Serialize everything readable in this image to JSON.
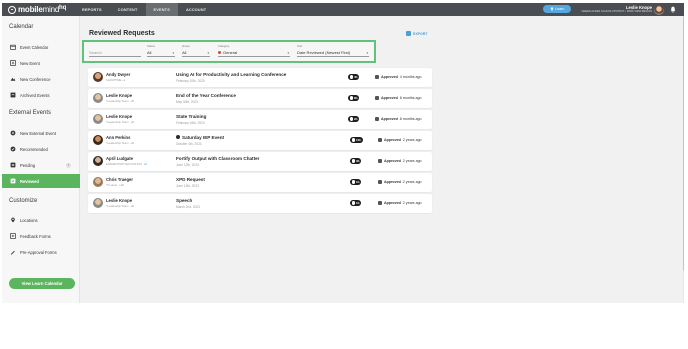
{
  "topbar": {
    "logo_brand": "mobile",
    "logo_brand2": "mind",
    "logo_suffix": "hq",
    "nav": [
      "REPORTS",
      "CONTENT",
      "EVENTS",
      "ACCOUNT"
    ],
    "active_nav": "EVENTS",
    "learn_label": "Learn",
    "user_name": "Leslie Knope",
    "user_district": "GREEN ACRES SCHOOL DISTRICT • PARK VIEW REGION",
    "icons": [
      "logo-icon",
      "lightbulb-icon",
      "avatar",
      "bell-icon"
    ]
  },
  "sidebar": {
    "sections": [
      {
        "title": "Calendar",
        "items": [
          {
            "label": "Event Calendar",
            "icon": "calendar-icon"
          },
          {
            "label": "New Event",
            "icon": "new-event-icon"
          },
          {
            "label": "New Conference",
            "icon": "conference-icon"
          },
          {
            "label": "Archived Events",
            "icon": "archive-icon"
          }
        ]
      },
      {
        "title": "External Events",
        "items": [
          {
            "label": "New External Event",
            "icon": "plus-circle-icon"
          },
          {
            "label": "Recommended",
            "icon": "check-circle-icon"
          },
          {
            "label": "Pending",
            "icon": "pending-icon"
          },
          {
            "label": "Reviewed",
            "icon": "reviewed-icon"
          }
        ]
      },
      {
        "title": "Customize",
        "items": [
          {
            "label": "Locations",
            "icon": "location-icon"
          },
          {
            "label": "Feedback Forms",
            "icon": "feedback-icon"
          },
          {
            "label": "Pre-Approval Forms",
            "icon": "preapproval-icon"
          }
        ]
      }
    ],
    "active_item": "Reviewed",
    "view_button": "View Learn Calendar"
  },
  "main": {
    "title": "Reviewed Requests",
    "export_label": "EXPORT",
    "filters": {
      "search_placeholder": "Search",
      "status_label": "Status",
      "status_value": "All",
      "group_label": "Group",
      "group_value": "All",
      "category_label": "Category",
      "category_value": "General",
      "sort_label": "Sort",
      "sort_value": "Date Reviewed (Newest First)"
    },
    "rows": [
      {
        "name": "Andy Dwyer",
        "sub": "SHOWTIME +1",
        "plus": "",
        "title": "Using AI for Productivity and Learning Conference",
        "star": false,
        "date": "February 10th, 2025",
        "pill": "4h",
        "status_prefix": "Approved",
        "status_time": "4 months ago"
      },
      {
        "name": "Leslie Knope",
        "sub": "*Leadership Team",
        "plus": "+8",
        "title": "End of the Year Conference",
        "star": false,
        "date": "May 30th, 2023",
        "pill": "8h",
        "status_prefix": "Approved",
        "status_time": "8 months ago"
      },
      {
        "name": "Leslie Knope",
        "sub": "*Leadership Team",
        "plus": "+8",
        "title": "State Training",
        "star": false,
        "date": "February 16th, 2024",
        "pill": "2h",
        "status_prefix": "Approved",
        "status_time": "8 months ago"
      },
      {
        "name": "Ann Perkins",
        "sub": "*Leadership Team",
        "plus": "+8",
        "title": "Saturday IEP Event",
        "star": true,
        "date": "October 4th, 2023",
        "pill": "11h",
        "status_prefix": "Approved",
        "status_time": "2 years ago"
      },
      {
        "name": "April Ludgate",
        "sub": "ELEMENTARY EDUCATION",
        "plus": "+8",
        "title": "Fortify Output with Classroom Chatter",
        "star": false,
        "date": "June 12th, 2023",
        "pill": "3h",
        "status_prefix": "Approved",
        "status_time": "2 years ago"
      },
      {
        "name": "Chris Traeger",
        "sub": "*5 Latest",
        "plus": "+10",
        "title": "XPD Request",
        "star": false,
        "date": "June 13th, 2023",
        "pill": "1h",
        "status_prefix": "Approved",
        "status_time": "2 years ago"
      },
      {
        "name": "Leslie Knope",
        "sub": "*Leadership Team",
        "plus": "+8",
        "title": "Speech",
        "star": false,
        "date": "March 2nd, 2023",
        "pill": "1h",
        "status_prefix": "Approved",
        "status_time": "2 years ago"
      }
    ]
  },
  "colors": {
    "topbar": "#4a4d52",
    "accent_green": "#5ab55e",
    "filter_outline": "#62c27c",
    "link_blue": "#4aa0dc"
  }
}
